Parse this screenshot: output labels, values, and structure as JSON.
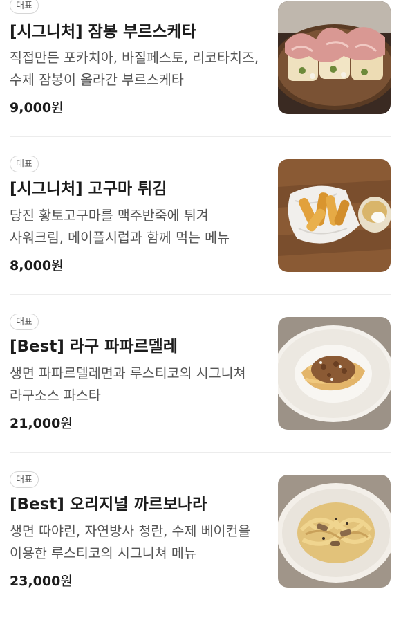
{
  "items": [
    {
      "badge": "대표",
      "title": "[시그니처] 잠봉 부르스케타",
      "description": "직접만든 포카치아, 바질페스토, 리코타치즈, 수제 잠봉이 올라간 부르스케타",
      "price": "9,000",
      "currency": "원",
      "image_icon": "bruschetta-photo"
    },
    {
      "badge": "대표",
      "title": "[시그니처] 고구마 튀김",
      "description": "당진 황토고구마를 맥주반죽에 튀겨 사워크림, 메이플시럽과 함께 먹는 메뉴",
      "price": "8,000",
      "currency": "원",
      "image_icon": "sweet-potato-fries-photo"
    },
    {
      "badge": "대표",
      "title": "[Best] 라구 파파르델레",
      "description": "생면 파파르델레면과 루스티코의 시그니쳐 라구소스 파스타",
      "price": "21,000",
      "currency": "원",
      "image_icon": "ragu-pasta-photo"
    },
    {
      "badge": "대표",
      "title": "[Best] 오리지널 까르보나라",
      "description": "생면 따야린, 자연방사 청란, 수제 베이컨을 이용한 루스티코의 시그니쳐 메뉴",
      "price": "23,000",
      "currency": "원",
      "image_icon": "carbonara-photo"
    }
  ]
}
